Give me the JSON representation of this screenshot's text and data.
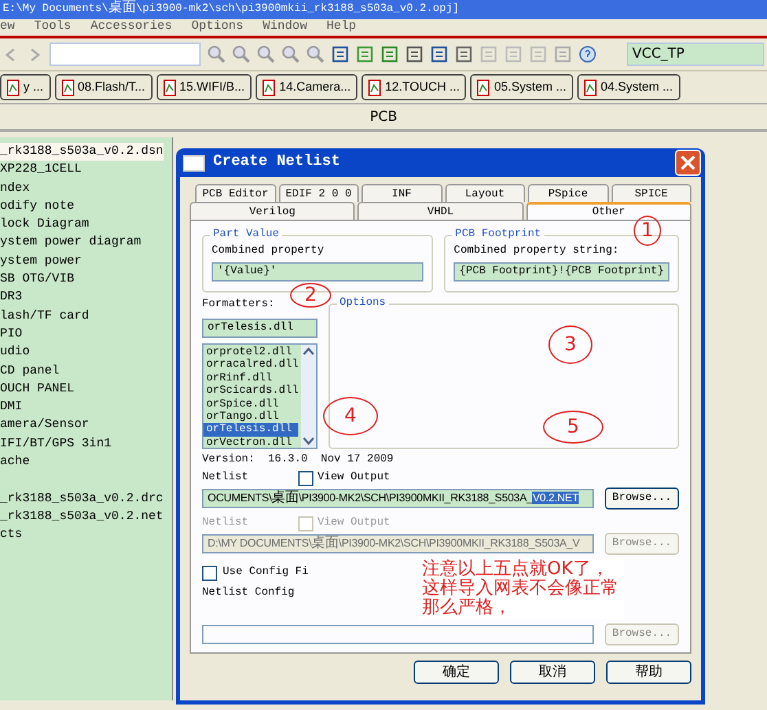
{
  "window": {
    "title": "E:\\My Documents\\桌面\\pi3900-mk2\\sch\\pi3900mkii_rk3188_s503a_v0.2.opj]"
  },
  "menu": [
    "ew",
    "Tools",
    "Accessories",
    "Options",
    "Window",
    "Help"
  ],
  "toolbar": {
    "net_value": "VCC_TP"
  },
  "doc_tabs": [
    {
      "label": "y ..."
    },
    {
      "label": "08.Flash/T..."
    },
    {
      "label": "15.WIFI/B..."
    },
    {
      "label": "14.Camera..."
    },
    {
      "label": "12.TOUCH ..."
    },
    {
      "label": "05.System ..."
    },
    {
      "label": "04.System ..."
    }
  ],
  "pane_title": "PCB",
  "tree": [
    {
      "label": "_rk3188_s503a_v0.2.dsn",
      "selected": true
    },
    {
      "label": "XP228_1CELL",
      "selected": false
    },
    {
      "label": "ndex",
      "selected": false
    },
    {
      "label": "odify note",
      "selected": false
    },
    {
      "label": "lock Diagram",
      "selected": false
    },
    {
      "label": "ystem power diagram",
      "selected": false
    },
    {
      "label": "ystem power",
      "selected": false
    },
    {
      "label": "SB OTG/VIB",
      "selected": false
    },
    {
      "label": "DR3",
      "selected": false
    },
    {
      "label": "lash/TF card",
      "selected": false
    },
    {
      "label": "PIO",
      "selected": false
    },
    {
      "label": "udio",
      "selected": false
    },
    {
      "label": "CD panel",
      "selected": false
    },
    {
      "label": "OUCH PANEL",
      "selected": false
    },
    {
      "label": "DMI",
      "selected": false
    },
    {
      "label": "amera/Sensor",
      "selected": false
    },
    {
      "label": "IFI/BT/GPS 3in1",
      "selected": false
    },
    {
      "label": "ache",
      "selected": false
    }
  ],
  "outputs": [
    {
      "label": "_rk3188_s503a_v0.2.drc"
    },
    {
      "label": "_rk3188_s503a_v0.2.net"
    },
    {
      "label": "cts"
    }
  ],
  "dialog": {
    "title": "Create Netlist",
    "tabs_row1": [
      {
        "label": "PCB Editor",
        "selected": false
      },
      {
        "label": "EDIF 2 0 0",
        "selected": false
      },
      {
        "label": "INF",
        "selected": false
      },
      {
        "label": "Layout",
        "selected": false
      },
      {
        "label": "PSpice",
        "selected": false
      },
      {
        "label": "SPICE",
        "selected": false
      }
    ],
    "tabs_row2": [
      {
        "label": "Verilog",
        "selected": false
      },
      {
        "label": "VHDL",
        "selected": false
      },
      {
        "label": "Other",
        "selected": true
      }
    ],
    "part_value": {
      "legend": "Part Value",
      "label": "Combined property",
      "value": "'{Value}'"
    },
    "pcb_footprint": {
      "legend": "PCB Footprint",
      "label": "Combined property string:",
      "value": "{PCB Footprint}!{PCB Footprint}"
    },
    "formatters_label": "Formatters:",
    "formatter_value": "orTelesis.dll",
    "formatters": [
      {
        "label": "orprotel2.dll",
        "selected": false
      },
      {
        "label": "orracalred.dll",
        "selected": false
      },
      {
        "label": "orRinf.dll",
        "selected": false
      },
      {
        "label": "orScicards.dll",
        "selected": false
      },
      {
        "label": "orSpice.dll",
        "selected": false
      },
      {
        "label": "orTango.dll",
        "selected": false
      },
      {
        "label": "orTelesis.dll",
        "selected": true
      },
      {
        "label": "orVectron.dll",
        "selected": false
      }
    ],
    "options_legend": "Options",
    "version": "Version:  16.3.0  Nov 17 2009",
    "outputs": [
      {
        "label": "Netlist",
        "check_label": "View Output",
        "checked": false,
        "disabled": false,
        "value": "OCUMENTS\\桌面\\PI3900-MK2\\SCH\\PI3900MKII_RK3188_S503A_",
        "selected_value": "V0.2.NET",
        "button": "Browse..."
      },
      {
        "label": "Netlist",
        "check_label": "View Output",
        "checked": false,
        "disabled": true,
        "value": "D:\\MY DOCUMENTS\\桌面\\PI3900-MK2\\SCH\\PI3900MKII_RK3188_S503A_V",
        "button": "Browse..."
      }
    ],
    "config": {
      "check_label": "Use Config Fi",
      "checked": false,
      "label": "Netlist Config",
      "button": "Browse...",
      "disabled": true
    },
    "buttons": [
      "确定",
      "取消",
      "帮助"
    ]
  },
  "circled_marks": [
    "1",
    "2",
    "3",
    "4",
    "5"
  ],
  "note": "注意以上五点就OK了，这样导入网表不会像正常那么严格，"
}
